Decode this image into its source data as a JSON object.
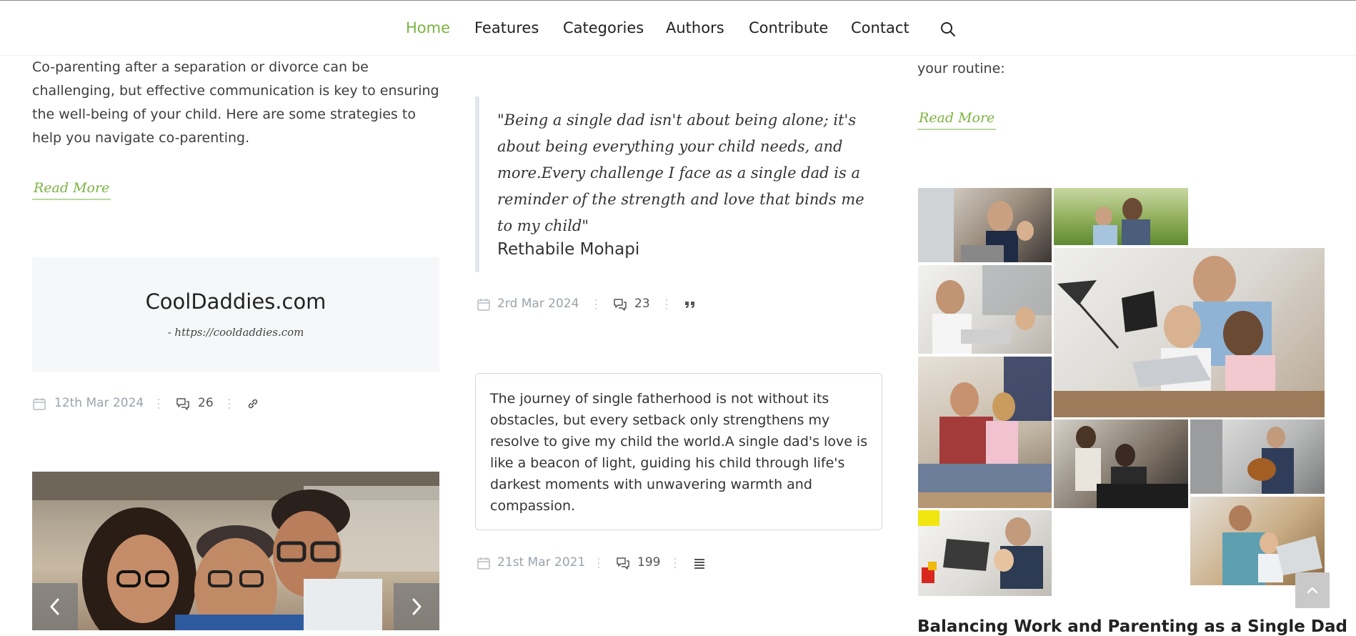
{
  "nav": {
    "items": [
      "Home",
      "Features",
      "Categories",
      "Authors",
      "Contribute",
      "Contact"
    ],
    "active": "Home"
  },
  "col1": {
    "excerpt": "Co-parenting after a separation or divorce can be challenging, but effective communication is key to ensuring the well-being of your child. Here are some strategies to help you navigate co-parenting.",
    "read_more": "Read More",
    "link_post": {
      "title": "CoolDaddies.com",
      "url": "- https://cooldaddies.com",
      "date": "12th Mar 2024",
      "comments": "26",
      "format_icon": "link-icon"
    }
  },
  "col2": {
    "quote": {
      "text": "\"Being a single dad isn't about being alone; it's about being everything your child needs, and more.Every challenge I face as a single dad is a reminder of the strength and love that binds me to my child\"",
      "author": "Rethabile Mohapi",
      "date": "2rd Mar 2024",
      "comments": "23",
      "format_icon": "quote-icon"
    },
    "status": {
      "text": "The journey of single fatherhood is not without its obstacles, but every setback only strengthens my resolve to give my child the world.A single dad's love is like a beacon of light, guiding his child through life's darkest moments with unwavering warmth and compassion.",
      "date": "21st Mar 2021",
      "comments": "199",
      "format_icon": "lines-icon"
    }
  },
  "col3": {
    "excerpt": "your routine:",
    "read_more": "Read More",
    "post_title": "Balancing Work and Parenting as a Single Dad"
  },
  "colors": {
    "accent": "#7cb342",
    "meta": "#9aa3ab",
    "text": "#333333",
    "box_bg": "#f6f7f8"
  }
}
